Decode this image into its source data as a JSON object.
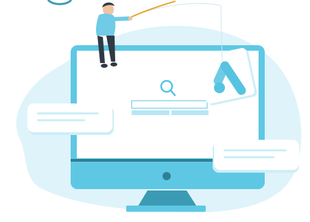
{
  "illustration": {
    "subject": "fishing-for-ads",
    "search_icon": "search-icon",
    "ads_logo": "google-ads-logo-icon",
    "colors": {
      "blob": "#dff3fa",
      "monitor_frame": "#5ec8e4",
      "monitor_dark": "#2f7f95",
      "screen": "#ffffff",
      "accent": "#56c3e0",
      "card": "#ffffff",
      "card_line": "#cdeef7",
      "figure_shirt": "#6fcbe6",
      "figure_pants": "#2f3a45",
      "fishing_line": "#e7a52f"
    }
  }
}
